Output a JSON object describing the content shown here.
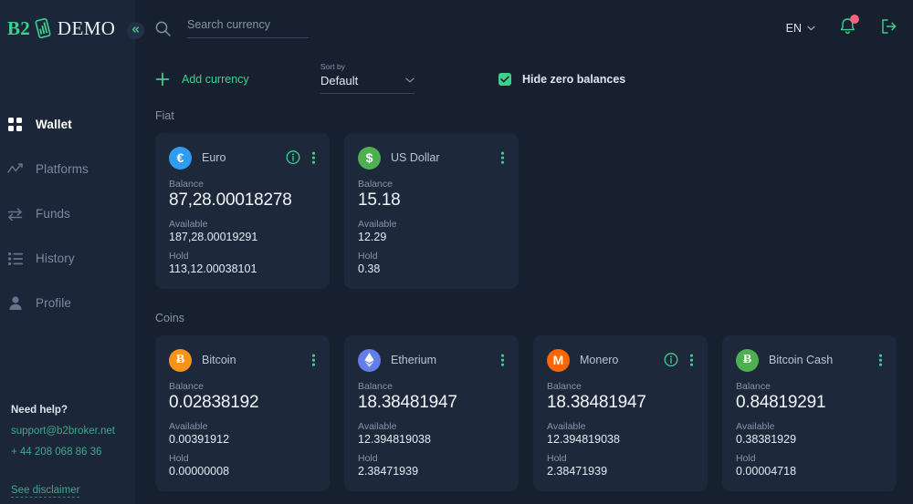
{
  "brand": {
    "b2": "B2",
    "demo": "DEMO",
    "logo_icon": "chart-tablet-icon"
  },
  "sidebar": {
    "collapse_icon": "chevrons-left-icon",
    "items": [
      {
        "label": "Wallet",
        "icon": "grid-icon",
        "active": true
      },
      {
        "label": "Platforms",
        "icon": "trend-icon",
        "active": false
      },
      {
        "label": "Funds",
        "icon": "transfer-icon",
        "active": false
      },
      {
        "label": "History",
        "icon": "list-icon",
        "active": false
      },
      {
        "label": "Profile",
        "icon": "person-icon",
        "active": false
      }
    ],
    "help": {
      "title": "Need help?",
      "email": "support@b2broker.net",
      "phone": "+ 44 208 068 86 36",
      "disclaimer": "See disclaimer"
    }
  },
  "header": {
    "search": {
      "placeholder": "Search currency",
      "value": "",
      "icon": "search-icon"
    },
    "language": {
      "value": "EN",
      "chevron_icon": "chevron-down-icon"
    },
    "notifications": {
      "icon": "bell-icon",
      "badge": ""
    },
    "logout": {
      "icon": "logout-icon"
    }
  },
  "toolbar": {
    "add_currency": {
      "label": "Add currency",
      "icon": "plus-icon"
    },
    "sort_by": {
      "label": "Sort by",
      "value": "Default",
      "chevron_icon": "chevron-down-icon"
    },
    "hide_zero": {
      "label": "Hide zero balances",
      "checked": true,
      "icon": "check-icon"
    }
  },
  "labels": {
    "balance": "Balance",
    "available": "Available",
    "hold": "Hold"
  },
  "sections": [
    {
      "title": "Fiat",
      "cards": [
        {
          "name": "Euro",
          "symbol": "€",
          "badge_color": "#2e9cf0",
          "badge_text_color": "#ffffff",
          "has_info": true,
          "balance": "87,28.00018278",
          "available": "187,28.00019291",
          "hold": "113,12.00038101"
        },
        {
          "name": "US Dollar",
          "symbol": "$",
          "badge_color": "#4caf50",
          "badge_text_color": "#ffffff",
          "has_info": false,
          "balance": "15.18",
          "available": "12.29",
          "hold": "0.38"
        }
      ]
    },
    {
      "title": "Coins",
      "cards": [
        {
          "name": "Bitcoin",
          "symbol": "Ƀ",
          "badge_color": "#f7931a",
          "badge_text_color": "#ffffff",
          "has_info": false,
          "balance": "0.02838192",
          "available": "0.00391912",
          "hold": "0.00000008"
        },
        {
          "name": "Etherium",
          "symbol": "◈",
          "badge_color": "#627eea",
          "badge_text_color": "#ffffff",
          "has_info": false,
          "balance": "18.38481947",
          "available": "12.394819038",
          "hold": "2.38471939"
        },
        {
          "name": "Monero",
          "symbol": "M",
          "badge_color": "#ff6600",
          "badge_text_color": "#ffffff",
          "has_info": true,
          "balance": "18.38481947",
          "available": "12.394819038",
          "hold": "2.38471939"
        },
        {
          "name": "Bitcoin Cash",
          "symbol": "Ƀ",
          "badge_color": "#4caf50",
          "badge_text_color": "#ffffff",
          "has_info": false,
          "balance": "0.84819291",
          "available": "0.38381929",
          "hold": "0.00004718"
        }
      ]
    }
  ],
  "colors": {
    "accent": "#3fd08e",
    "sidebar_bg": "#1b2738",
    "page_bg": "#16202f",
    "card_bg": "#1d293b",
    "badge_red": "#f2647b"
  }
}
